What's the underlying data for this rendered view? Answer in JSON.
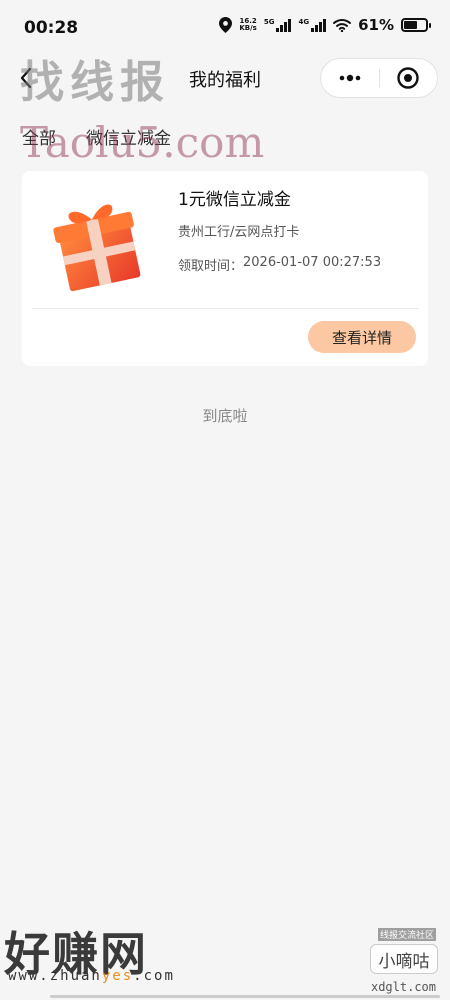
{
  "status_bar": {
    "time": "00:28",
    "net_speed_value": "16.2",
    "net_speed_unit": "KB/s",
    "signal_5g": "5G",
    "signal_4g": "4G",
    "battery_percent": "61%",
    "battery_level": 0.61
  },
  "nav": {
    "title": "我的福利",
    "back_icon": "chevron-left-icon",
    "more_icon": "more-dots-icon",
    "close_icon": "target-close-icon"
  },
  "tabs": [
    {
      "label": "全部"
    },
    {
      "label": "微信立减金"
    }
  ],
  "card": {
    "title": "1元微信立减金",
    "source": "贵州工行/云网点打卡",
    "time_label": "领取时间：",
    "time_value": "2026-01-07 00:27:53",
    "button_label": "查看详情",
    "image_icon": "gift-box-icon"
  },
  "end_text": "到底啦",
  "watermarks": {
    "top": "找线报",
    "taolu": "Taolu5.com",
    "bottom_main": "好赚网",
    "bottom_url_prefix": "www.zhuan",
    "bottom_url_highlight": "yes",
    "bottom_url_suffix": ".com",
    "xd_small": "线报交流社区",
    "xd_name": "小嘀咕",
    "xd_url": "xdglt.com"
  },
  "colors": {
    "background": "#f5f5f5",
    "card": "#ffffff",
    "button": "#fbc8a3",
    "gift_primary": "#f0562f",
    "gift_ribbon": "#f7d2c2"
  }
}
